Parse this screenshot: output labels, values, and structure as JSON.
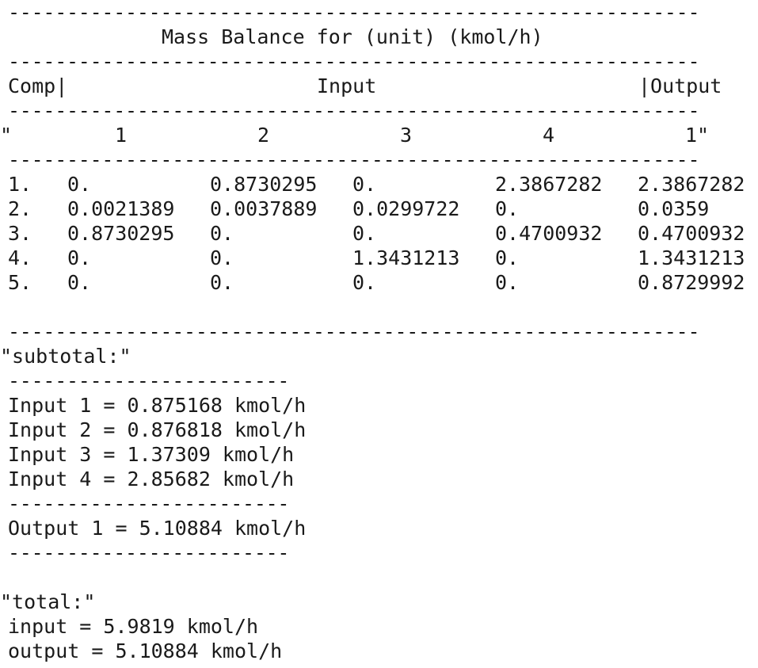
{
  "rule_long": "-----------------------------------------------------------",
  "rule_short": "------------------------",
  "title": "Mass Balance for (unit) (kmol/h)",
  "header": {
    "comp": "Comp|",
    "input": "Input",
    "output": "|Output"
  },
  "stream_numbers": {
    "open_quote": "\"",
    "n1": "1",
    "n2": "2",
    "n3": "3",
    "n4": "4",
    "out1": "1\""
  },
  "rows": [
    {
      "comp": "1.",
      "in1": "0.",
      "in2": "0.8730295",
      "in3": "0.",
      "in4": "2.3867282",
      "out1": "2.3867282"
    },
    {
      "comp": "2.",
      "in1": "0.0021389",
      "in2": "0.0037889",
      "in3": "0.0299722",
      "in4": "0.",
      "out1": "0.0359"
    },
    {
      "comp": "3.",
      "in1": "0.8730295",
      "in2": "0.",
      "in3": "0.",
      "in4": "0.4700932",
      "out1": "0.4700932"
    },
    {
      "comp": "4.",
      "in1": "0.",
      "in2": "0.",
      "in3": "1.3431213",
      "in4": "0.",
      "out1": "1.3431213"
    },
    {
      "comp": "5.",
      "in1": "0.",
      "in2": "0.",
      "in3": "0.",
      "in4": "0.",
      "out1": "0.8729992"
    }
  ],
  "subtotal": {
    "label": "\"subtotal:\"",
    "inputs": [
      "Input 1 = 0.875168 kmol/h",
      "Input 2 = 0.876818 kmol/h",
      "Input 3 = 1.37309 kmol/h",
      "Input 4 = 2.85682 kmol/h"
    ],
    "output": "Output 1 = 5.10884 kmol/h"
  },
  "total": {
    "label": "\"total:\"",
    "input": "input = 5.9819 kmol/h",
    "output": "output = 5.10884 kmol/h"
  }
}
